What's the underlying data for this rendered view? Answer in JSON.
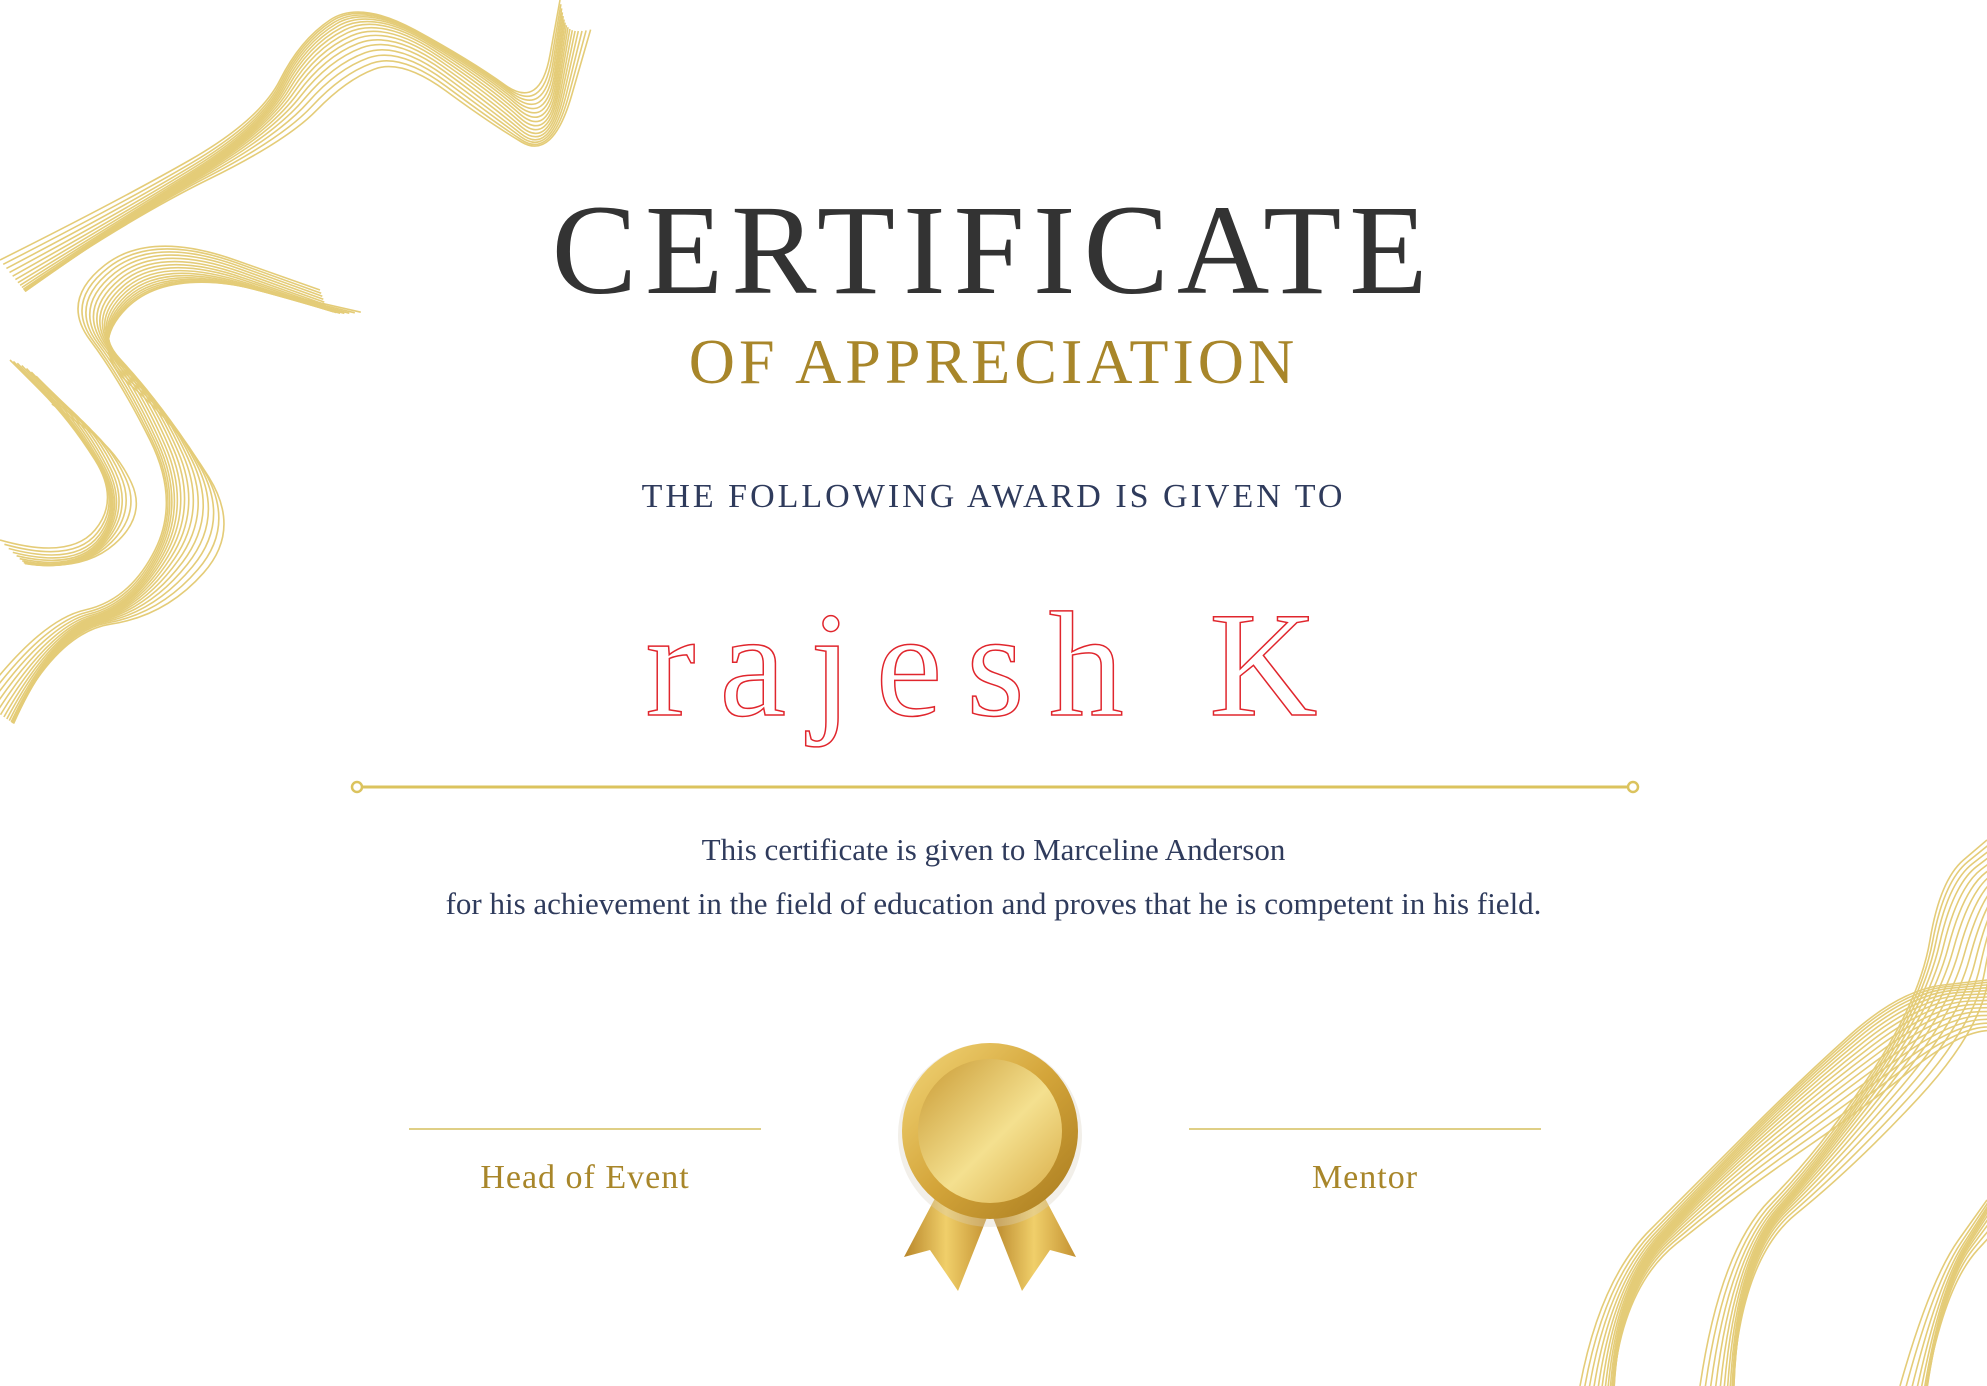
{
  "certificate": {
    "title": "CERTIFICATE",
    "subtitle": "OF APPRECIATION",
    "award_line": "THE FOLLOWING AWARD IS GIVEN TO",
    "recipient_name": "rajesh K",
    "description": [
      "This certificate is given to Marceline Anderson",
      "for his achievement in the field of education and proves that he is competent in his field."
    ],
    "signatures": {
      "left_label": "Head of Event",
      "right_label": "Mentor"
    }
  },
  "decorations": {
    "corner_waves": [
      "top-left",
      "bottom-right"
    ],
    "divider_icon": "divider-line-with-end-dots",
    "seal_icon": "gold-award-medal-with-ribbon"
  },
  "colors": {
    "title": "#333333",
    "gold": "#a8862a",
    "wave_gold": "#e2c76a",
    "navy_text": "#2f3b5c",
    "recipient_outline": "#e0262d",
    "background": "#ffffff"
  }
}
